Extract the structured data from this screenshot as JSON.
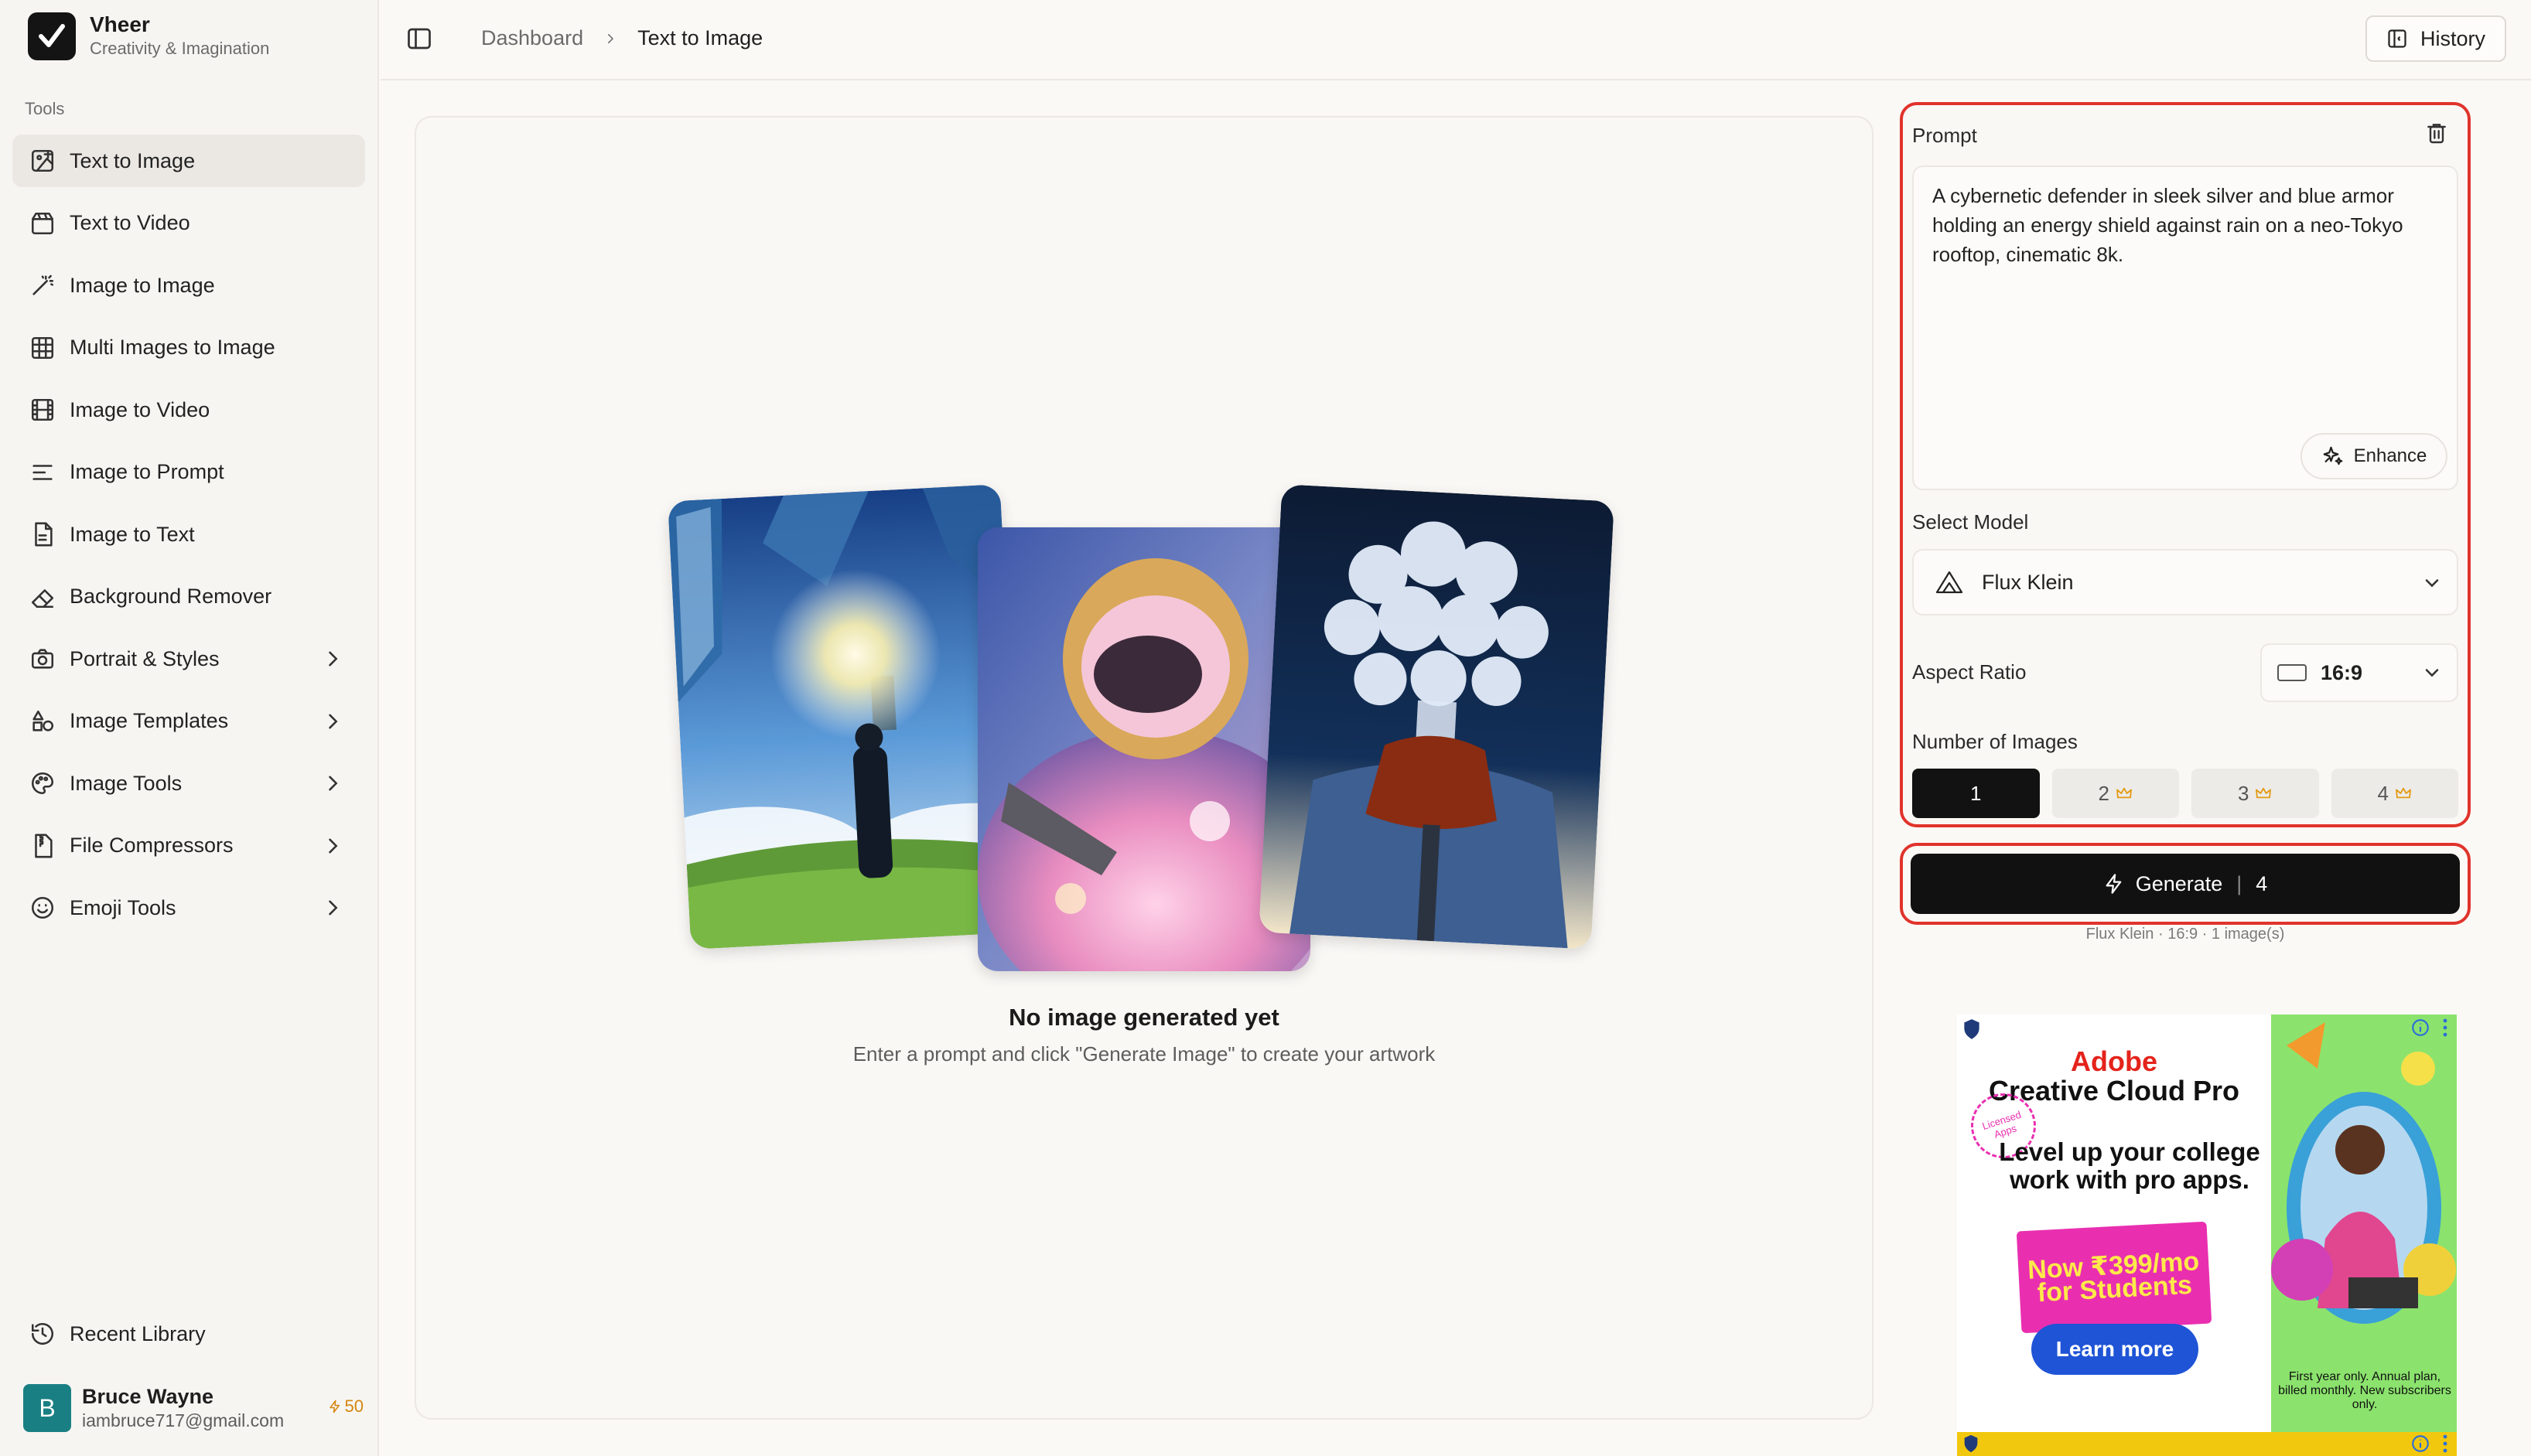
{
  "app": {
    "name": "Vheer",
    "tagline": "Creativity & Imagination"
  },
  "sidebar": {
    "section_label": "Tools",
    "items": [
      {
        "label": "Text to Image",
        "icon": "image-plus-icon",
        "active": true,
        "expandable": false
      },
      {
        "label": "Text to Video",
        "icon": "clapperboard-icon",
        "active": false,
        "expandable": false
      },
      {
        "label": "Image to Image",
        "icon": "magic-wand-icon",
        "active": false,
        "expandable": false
      },
      {
        "label": "Multi Images to Image",
        "icon": "grid-icon",
        "active": false,
        "expandable": false
      },
      {
        "label": "Image to Video",
        "icon": "film-icon",
        "active": false,
        "expandable": false
      },
      {
        "label": "Image to Prompt",
        "icon": "text-lines-icon",
        "active": false,
        "expandable": false
      },
      {
        "label": "Image to Text",
        "icon": "document-icon",
        "active": false,
        "expandable": false
      },
      {
        "label": "Background Remover",
        "icon": "eraser-icon",
        "active": false,
        "expandable": false
      },
      {
        "label": "Portrait & Styles",
        "icon": "camera-icon",
        "active": false,
        "expandable": true
      },
      {
        "label": "Image Templates",
        "icon": "shapes-icon",
        "active": false,
        "expandable": true
      },
      {
        "label": "Image Tools",
        "icon": "palette-icon",
        "active": false,
        "expandable": true
      },
      {
        "label": "File Compressors",
        "icon": "file-zip-icon",
        "active": false,
        "expandable": true
      },
      {
        "label": "Emoji Tools",
        "icon": "smiley-icon",
        "active": false,
        "expandable": true
      }
    ],
    "recent_label": "Recent Library",
    "user": {
      "initial": "B",
      "name": "Bruce Wayne",
      "email": "iambruce717@gmail.com",
      "credits": "50"
    }
  },
  "header": {
    "breadcrumb": [
      "Dashboard",
      "Text to Image"
    ],
    "history_label": "History"
  },
  "canvas": {
    "empty_title": "No image generated yet",
    "empty_subtitle": "Enter a prompt and click \"Generate Image\" to create your artwork"
  },
  "panel": {
    "prompt_label": "Prompt",
    "prompt_value": "A cybernetic defender in sleek silver and blue armor holding an energy shield against rain on a neo-Tokyo rooftop, cinematic 8k.",
    "enhance_label": "Enhance",
    "model_label": "Select Model",
    "model_value": "Flux Klein",
    "aspect_label": "Aspect Ratio",
    "aspect_value": "16:9",
    "count_label": "Number of Images",
    "counts": [
      {
        "label": "1",
        "premium": false,
        "selected": true
      },
      {
        "label": "2",
        "premium": true,
        "selected": false
      },
      {
        "label": "3",
        "premium": true,
        "selected": false
      },
      {
        "label": "4",
        "premium": true,
        "selected": false
      }
    ],
    "generate_label": "Generate",
    "generate_cost": "4",
    "summary": "Flux Klein · 16:9 · 1 image(s)"
  },
  "ad": {
    "brand": "Adobe",
    "product": "Creative Cloud Pro",
    "badge": "Licensed Apps",
    "headline": "Level up your college work with pro apps.",
    "price_line1": "Now ₹399/mo",
    "price_line2": "for Students",
    "cta": "Learn more",
    "fine_print": "First year only. Annual plan, billed monthly. New subscribers only."
  },
  "colors": {
    "accent_outline": "#e0332b",
    "primary_button": "#111111",
    "credit": "#d4860f",
    "avatar": "#1a7f83"
  }
}
